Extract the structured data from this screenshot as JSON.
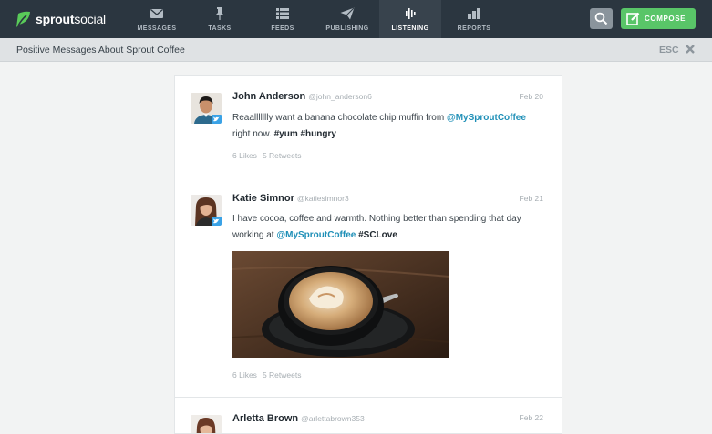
{
  "brand": {
    "name_bold": "sprout",
    "name_light": "social"
  },
  "nav": {
    "items": [
      {
        "label": "MESSAGES",
        "icon": "envelope-icon"
      },
      {
        "label": "TASKS",
        "icon": "pin-icon"
      },
      {
        "label": "FEEDS",
        "icon": "list-icon"
      },
      {
        "label": "PUBLISHING",
        "icon": "paper-plane-icon"
      },
      {
        "label": "LISTENING",
        "icon": "waveform-icon",
        "active": true
      },
      {
        "label": "REPORTS",
        "icon": "bar-chart-icon"
      }
    ],
    "compose_label": "COMPOSE"
  },
  "subheader": {
    "title": "Positive Messages About Sprout Coffee",
    "esc_label": "ESC"
  },
  "posts": [
    {
      "name": "John Anderson",
      "handle": "@john_anderson6",
      "date": "Feb 20",
      "text_1": "Reaallllllly want a banana chocolate chip muffin from ",
      "mention": "@MySproutCoffee",
      "text_2": "right now. ",
      "hashtags": [
        "#yum",
        "#hungry"
      ],
      "likes": "6 Likes",
      "retweets": "5 Retweets"
    },
    {
      "name": "Katie Simnor",
      "handle": "@katiesimnor3",
      "date": "Feb 21",
      "text_1": "I have cocoa, coffee and warmth. Nothing better than spending that day working at ",
      "mention": "@MySproutCoffee",
      "hashtags": [
        "#SCLove"
      ],
      "likes": "6 Likes",
      "retweets": "5 Retweets"
    },
    {
      "name": "Arletta Brown",
      "handle": "@arlettabrown353",
      "date": "Feb 22"
    }
  ],
  "colors": {
    "nav_bg": "#2b3640",
    "nav_active": "#38434d",
    "compose_green": "#59c568",
    "brand_green": "#59cb59",
    "mention_blue": "#1e8fb7",
    "twitter_blue": "#3aa2e6"
  }
}
